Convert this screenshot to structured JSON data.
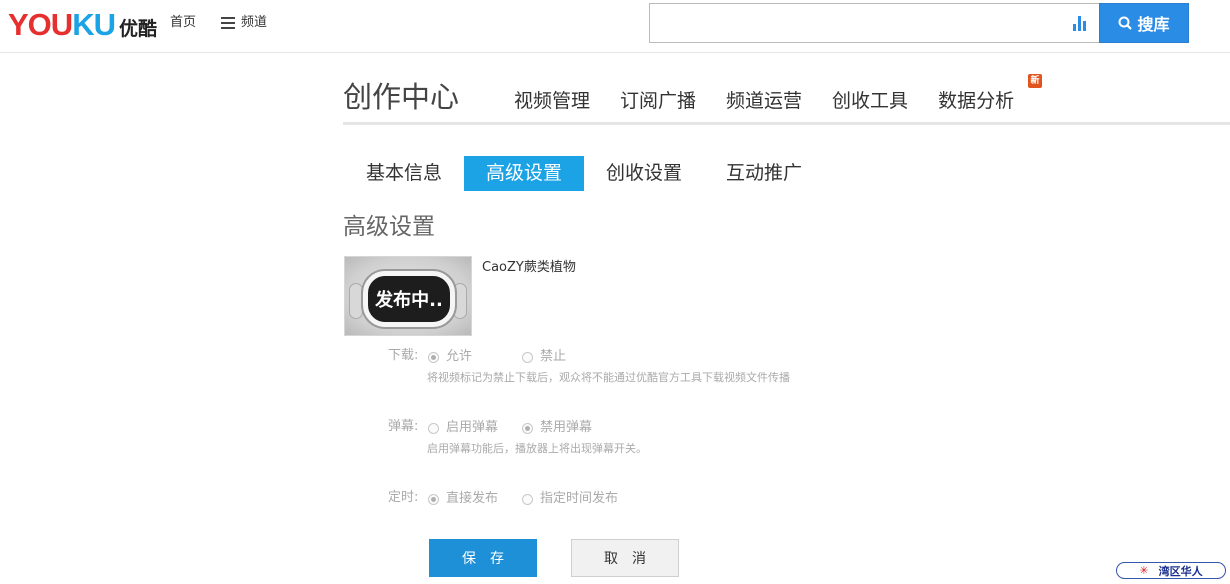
{
  "header": {
    "logo_en": "YOUKU",
    "logo_cn": "优酷",
    "nav_home": "首页",
    "nav_channel": "频道",
    "search_placeholder": "",
    "search_button": "搜库"
  },
  "creation_center": {
    "title": "创作中心",
    "nav": [
      "视频管理",
      "订阅广播",
      "频道运营",
      "创收工具",
      "数据分析"
    ],
    "new_badge": "新"
  },
  "subtabs": {
    "items": [
      "基本信息",
      "高级设置",
      "创收设置",
      "互动推广"
    ],
    "active_index": 1
  },
  "section_title": "高级设置",
  "video": {
    "thumbnail_text": "发布中..",
    "name": "CaoZY蕨类植物"
  },
  "form": {
    "download": {
      "label": "下载:",
      "options": [
        "允许",
        "禁止"
      ],
      "selected": "允许",
      "hint": "将视频标记为禁止下载后，观众将不能通过优酷官方工具下载视频文件传播"
    },
    "danmaku": {
      "label": "弹幕:",
      "options": [
        "启用弹幕",
        "禁用弹幕"
      ],
      "selected": "禁用弹幕",
      "hint": "启用弹幕功能后，播放器上将出现弹幕开关。"
    },
    "schedule": {
      "label": "定时:",
      "options": [
        "直接发布",
        "指定时间发布"
      ],
      "selected": "直接发布"
    },
    "save_button": "保存",
    "cancel_button": "取消"
  },
  "watermark": {
    "text": "湾区华人"
  },
  "colors": {
    "accent_blue": "#1ba3e6",
    "search_blue": "#2b8ce6",
    "logo_red": "#e62f2f",
    "badge_orange": "#e0541e"
  }
}
